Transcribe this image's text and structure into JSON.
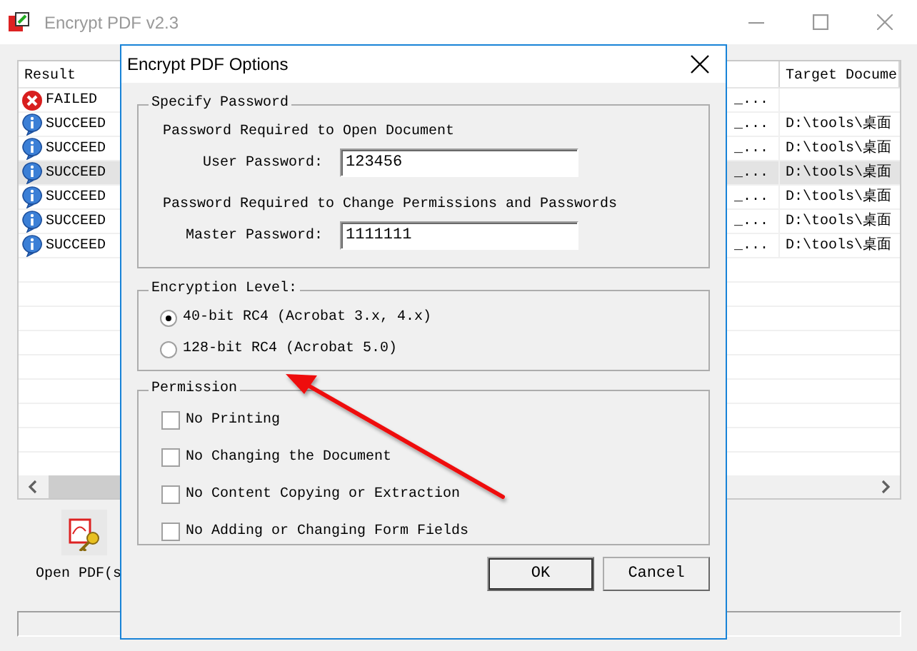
{
  "window": {
    "title": "Encrypt PDF v2.3"
  },
  "table": {
    "columns": [
      {
        "label": "Result"
      },
      {
        "label": "Target Docume"
      }
    ],
    "rows": [
      {
        "kind": "error",
        "status": "FAILED",
        "column_2": "_...",
        "selected": false
      },
      {
        "kind": "info",
        "status": "SUCCEED",
        "column_2": "_...",
        "target": "D:\\tools\\桌面",
        "selected": false
      },
      {
        "kind": "info",
        "status": "SUCCEED",
        "column_2": "_...",
        "target": "D:\\tools\\桌面",
        "selected": false
      },
      {
        "kind": "info",
        "status": "SUCCEED",
        "column_2": "_...",
        "target": "D:\\tools\\桌面",
        "selected": true
      },
      {
        "kind": "info",
        "status": "SUCCEED",
        "column_2": "_...",
        "target": "D:\\tools\\桌面",
        "selected": false
      },
      {
        "kind": "info",
        "status": "SUCCEED",
        "column_2": "_...",
        "target": "D:\\tools\\桌面",
        "selected": false
      },
      {
        "kind": "info",
        "status": "SUCCEED",
        "column_2": "_...",
        "target": "D:\\tools\\桌面",
        "selected": false
      }
    ]
  },
  "toolbar": [
    {
      "label": "Open PDF(s"
    }
  ],
  "dialog": {
    "title": "Encrypt PDF Options",
    "password": {
      "title": "Specify Password",
      "open_heading": "Password Required to Open Document",
      "user_label": "User Password:",
      "user_value": "123456",
      "change_heading": "Password Required to Change Permissions and Passwords",
      "master_label": "Master Password:",
      "master_value": "1111111"
    },
    "encryption": {
      "title": "Encryption Level:",
      "options": [
        {
          "label": "40-bit RC4 (Acrobat 3.x, 4.x)",
          "selected": true
        },
        {
          "label": "128-bit RC4 (Acrobat 5.0)",
          "selected": false
        }
      ]
    },
    "permission": {
      "title": "Permission",
      "options": [
        {
          "label": "No Printing",
          "checked": false
        },
        {
          "label": "No Changing the Document",
          "checked": false
        },
        {
          "label": "No Content Copying or Extraction",
          "checked": false
        },
        {
          "label": "No Adding or Changing Form Fields",
          "checked": false
        }
      ]
    },
    "buttons": [
      {
        "label": "OK"
      },
      {
        "label": "Cancel"
      }
    ]
  }
}
